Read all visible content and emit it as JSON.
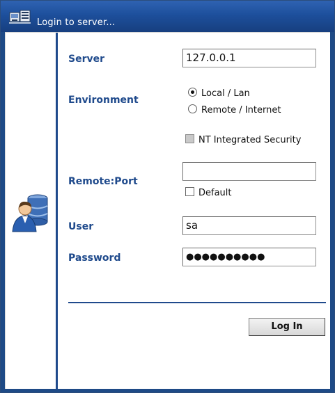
{
  "window": {
    "title": "Login to server...",
    "title_icon": "server-icon"
  },
  "form": {
    "server": {
      "label": "Server",
      "value": "127.0.0.1"
    },
    "environment": {
      "label": "Environment",
      "options": [
        {
          "label": "Local / Lan",
          "selected": true
        },
        {
          "label": "Remote / Internet",
          "selected": false
        }
      ],
      "nt_security": {
        "label": "NT Integrated Security",
        "checked": false,
        "enabled": false
      }
    },
    "remote_port": {
      "label": "Remote:Port",
      "value": "",
      "default": {
        "label": "Default",
        "checked": false
      }
    },
    "user": {
      "label": "User",
      "value": "sa"
    },
    "password": {
      "label": "Password",
      "value": "●●●●●●●●●●"
    }
  },
  "actions": {
    "login_label": "Log In"
  },
  "icons": {
    "avatar": "database-user-icon"
  },
  "colors": {
    "title_bar": "#1d4f9c",
    "label_blue": "#1f4a8c",
    "accent_rule": "#1f4a8c"
  }
}
